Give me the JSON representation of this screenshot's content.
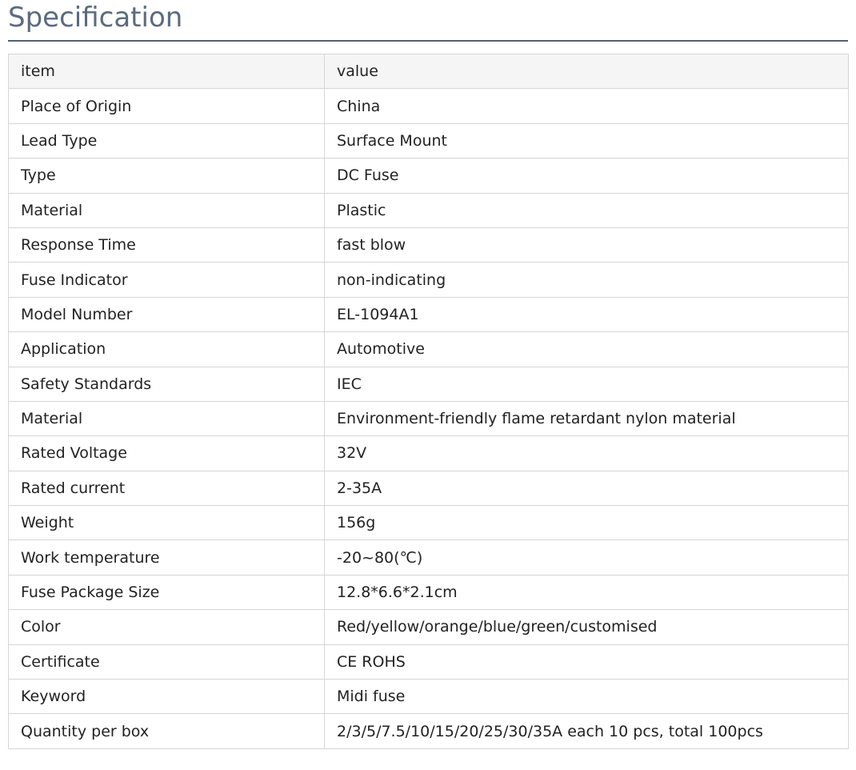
{
  "heading": {
    "title": "Specification"
  },
  "table": {
    "columns": [
      "item",
      "value"
    ],
    "rows": [
      [
        "Place of Origin",
        "China"
      ],
      [
        "Lead Type",
        "Surface Mount"
      ],
      [
        "Type",
        "DC Fuse"
      ],
      [
        "Material",
        "Plastic"
      ],
      [
        "Response Time",
        "fast blow"
      ],
      [
        "Fuse Indicator",
        "non-indicating"
      ],
      [
        "Model Number",
        "EL-1094A1"
      ],
      [
        "Application",
        "Automotive"
      ],
      [
        "Safety Standards",
        "IEC"
      ],
      [
        "Material",
        "Environment-friendly flame retardant nylon material"
      ],
      [
        "Rated Voltage",
        "32V"
      ],
      [
        "Rated current",
        "2-35A"
      ],
      [
        "Weight",
        "156g"
      ],
      [
        "Work temperature",
        "-20~80(℃)"
      ],
      [
        "Fuse Package Size",
        "12.8*6.6*2.1cm"
      ],
      [
        "Color",
        "Red/yellow/orange/blue/green/customised"
      ],
      [
        "Certificate",
        "CE ROHS"
      ],
      [
        "Keyword",
        "Midi fuse"
      ],
      [
        "Quantity per box",
        "2/3/5/7.5/10/15/20/25/30/35A each 10 pcs, total 100pcs"
      ]
    ]
  },
  "colors": {
    "heading_text": "#5b6b80",
    "heading_rule": "#55606d",
    "header_row_bg": "#f5f5f5",
    "cell_border": "#d6d6d6",
    "text": "#222222"
  }
}
